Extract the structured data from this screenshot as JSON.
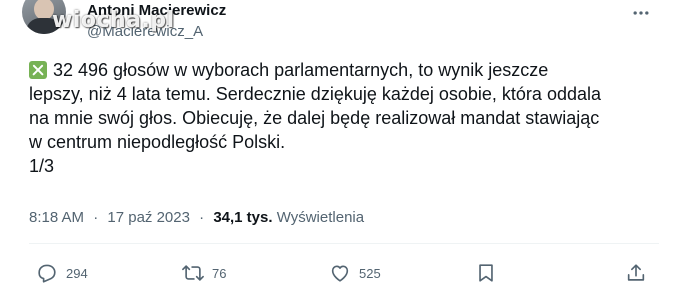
{
  "author": {
    "name": "Antoni Macierewicz",
    "handle": "@Macierewicz_A"
  },
  "watermark": "wiocha.pl",
  "tweet": {
    "check_emoji": "check-mark-button-icon",
    "text": "32 496 głosów w wyborach parlamentarnych, to wynik jeszcze\nlepszy, niż 4 lata temu. Serdecznie dziękuję każdej osobie, która oddala\nna mnie swój głos. Obiecuję, że dalej będę realizował mandat stawiając\nw centrum niepodległość Polski.\n1/3"
  },
  "meta": {
    "time": "8:18 AM",
    "date": "17 paź 2023",
    "separator": "·",
    "views_count": "34,1 tys.",
    "views_label": "Wyświetlenia"
  },
  "actions": {
    "replies": "294",
    "retweets": "76",
    "likes": "525"
  },
  "colors": {
    "text": "#0f1419",
    "secondary": "#536471",
    "check_green": "#77b255",
    "divider": "#eff3f4"
  }
}
